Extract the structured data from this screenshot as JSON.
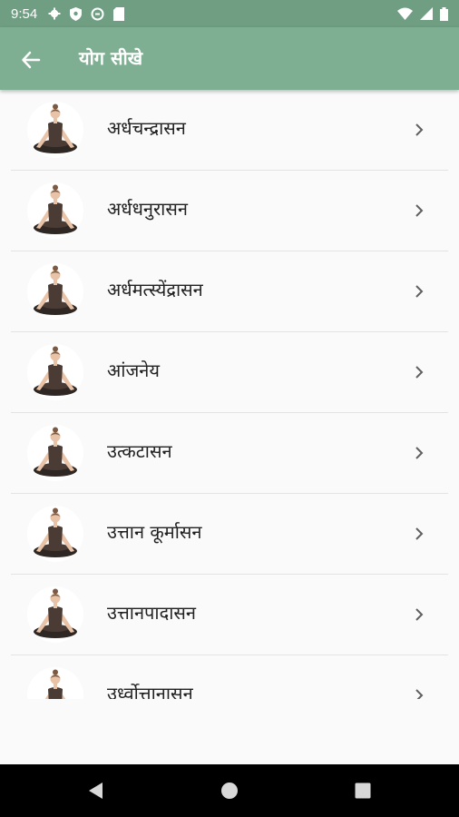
{
  "status_bar": {
    "time": "9:54",
    "left_icons": [
      "gear-icon",
      "shield-icon",
      "sync-icon",
      "sd-card-icon"
    ],
    "right_icons": [
      "wifi-icon",
      "signal-icon",
      "battery-icon"
    ]
  },
  "app_bar": {
    "title": "योग सीखे",
    "back_icon": "arrow-back-icon",
    "color": "#7faf92"
  },
  "items": [
    {
      "label": "अर्धचन्द्रासन",
      "icon": "yoga-lotus-pose-icon"
    },
    {
      "label": "अर्धधनुरासन",
      "icon": "yoga-lotus-pose-icon"
    },
    {
      "label": "अर्धमत्स्येंद्रासन",
      "icon": "yoga-lotus-pose-icon"
    },
    {
      "label": "आंजनेय",
      "icon": "yoga-lotus-pose-icon"
    },
    {
      "label": "उत्कटासन",
      "icon": "yoga-lotus-pose-icon"
    },
    {
      "label": "उत्तान कूर्मासन",
      "icon": "yoga-lotus-pose-icon"
    },
    {
      "label": "उत्तानपादासन",
      "icon": "yoga-lotus-pose-icon"
    },
    {
      "label": "उर्ध्वोत्तानासन",
      "icon": "yoga-lotus-pose-icon"
    }
  ],
  "nav_bar": {
    "buttons": [
      "back-triangle-icon",
      "home-circle-icon",
      "recents-square-icon"
    ]
  }
}
